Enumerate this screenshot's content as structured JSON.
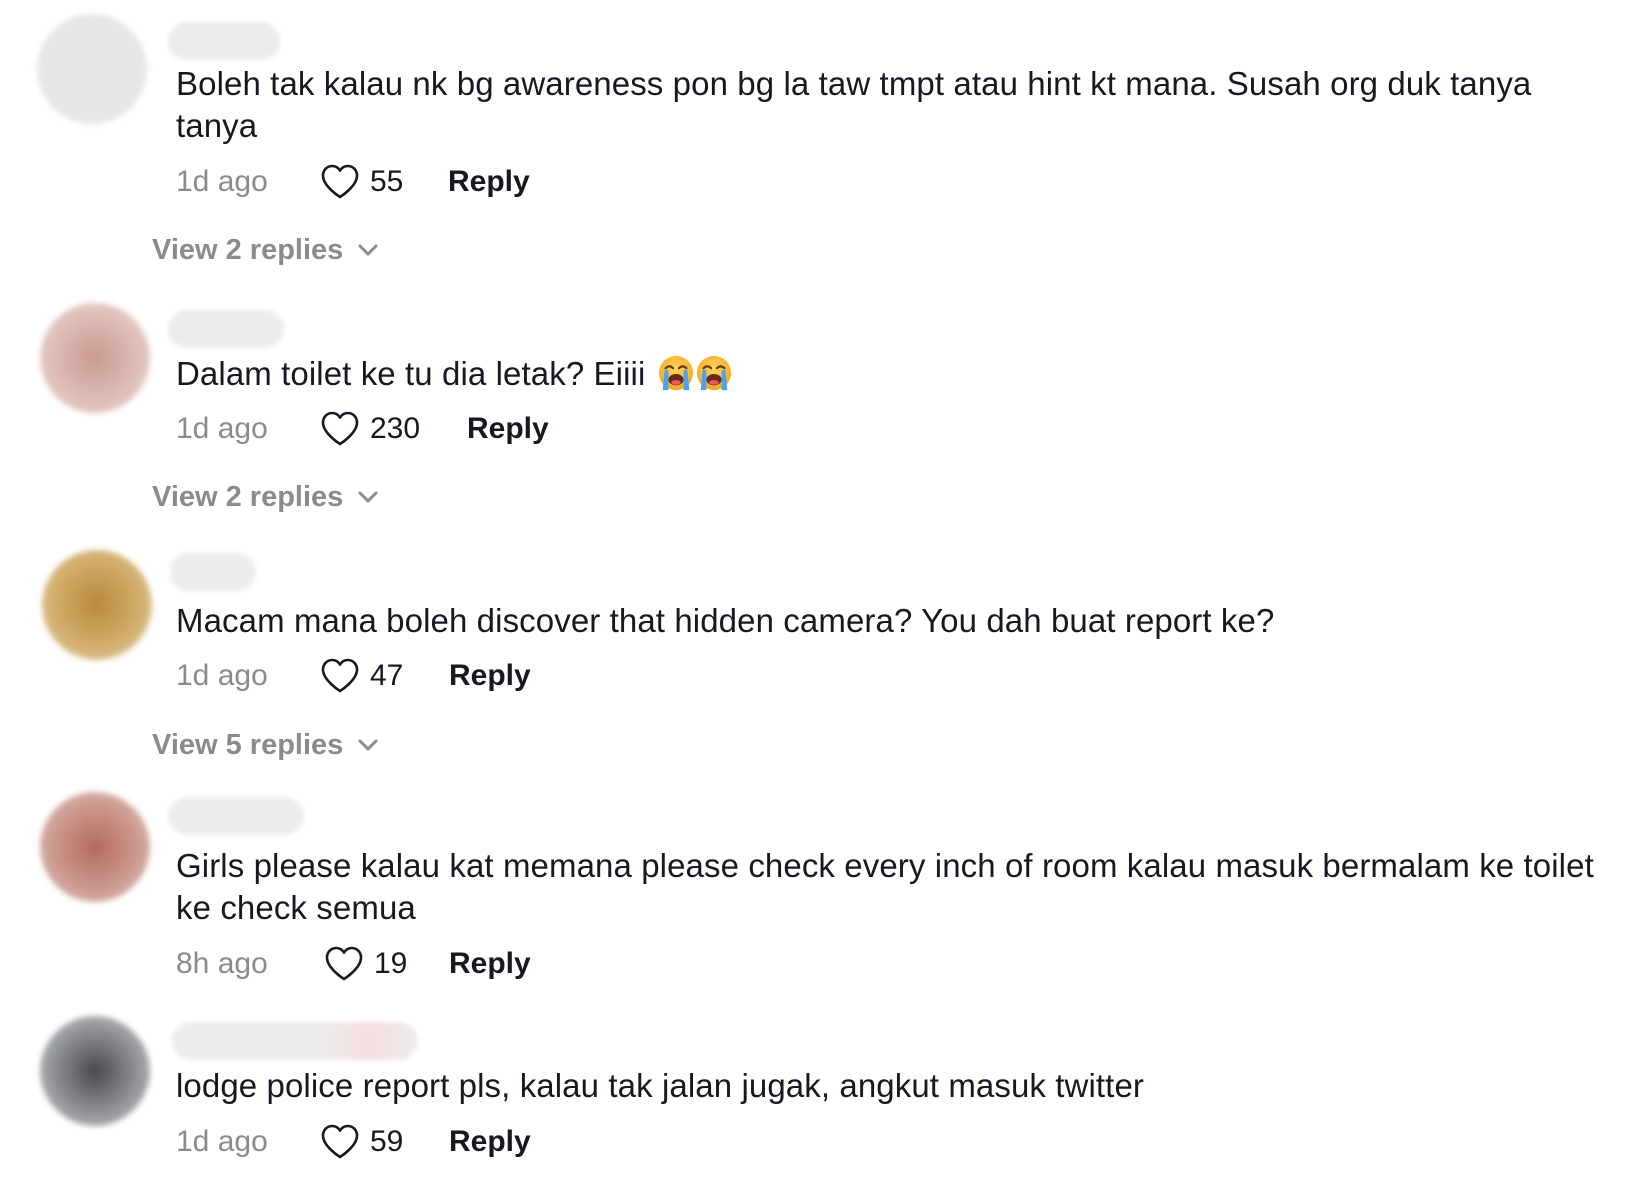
{
  "comments": [
    {
      "text": "Boleh tak kalau nk bg awareness pon bg la taw tmpt atau hint kt mana. Susah org duk tanya tanya",
      "time": "1d ago",
      "likes": "55",
      "reply_label": "Reply",
      "view_replies": "View 2 replies"
    },
    {
      "text": "Dalam toilet ke tu dia letak? Eiiii",
      "emoji": "loudly-crying-face x2",
      "time": "1d ago",
      "likes": "230",
      "reply_label": "Reply",
      "view_replies": "View 2 replies"
    },
    {
      "text": "Macam mana boleh discover that hidden camera? You dah buat report ke?",
      "time": "1d ago",
      "likes": "47",
      "reply_label": "Reply",
      "view_replies": "View 5 replies"
    },
    {
      "text": "Girls please kalau kat memana please check every inch of room kalau masuk bermalam ke toilet ke check semua",
      "time": "8h ago",
      "likes": "19",
      "reply_label": "Reply"
    },
    {
      "text": "lodge police report pls, kalau tak jalan jugak, angkut masuk twitter",
      "time": "1d ago",
      "likes": "59",
      "reply_label": "Reply"
    }
  ],
  "colors": {
    "primary_text": "#161823",
    "secondary_text": "#8a8b91",
    "background": "#ffffff"
  },
  "icons": {
    "like": "heart-outline-icon",
    "expand": "chevron-down-icon",
    "emoji": "loudly-crying-face-emoji"
  }
}
